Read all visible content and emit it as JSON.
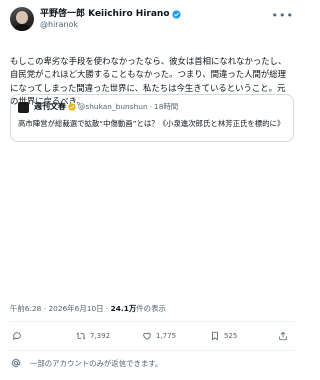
{
  "author": {
    "display_name": "平野啓一郎 Keiichiro Hirano",
    "handle": "@hiranok"
  },
  "post": {
    "lines": [
      "もしこの卑劣な手段を使わなかったなら、彼女は首相になれなかったし、",
      "自民党がこれほど大勝することもなかった。つまり、間違った人間が総理",
      "になってしまった間違った世界に、私たちは今生きているということ。元",
      "の世界に戻るべき。"
    ]
  },
  "quote": {
    "name": "週刊文春",
    "handle": "@shukan_bunshun",
    "separator": "·",
    "time": "18時間",
    "text": "高市陣営が総裁選で拡散“中傷動画”とは？《小泉進次郎氏と林芳正氏を標的に》"
  },
  "meta": {
    "time": "午前6:28",
    "dot1": "·",
    "date": "2026年6月10日",
    "dot2": "·",
    "views_value": "24.1万",
    "views_suffix": "件の表示"
  },
  "actions": {
    "replies": "",
    "reposts": "7,392",
    "likes": "1,775",
    "bookmarks": "525"
  },
  "reply_notice": "一部のアカウントのみが返信できます。",
  "icons": {
    "verified": "verified-badge-icon",
    "more": "more-dots-icon",
    "reply": "reply-bubble-icon",
    "repost": "repost-icon",
    "like": "heart-icon",
    "bookmark": "bookmark-icon",
    "share": "share-upload-icon",
    "notice": "at-sign-icon"
  },
  "colors": {
    "verified_blue": "#1d9bf0",
    "quote_verified_gold": "#e2b719",
    "muted_text": "#536471",
    "border": "#cfd9de"
  }
}
